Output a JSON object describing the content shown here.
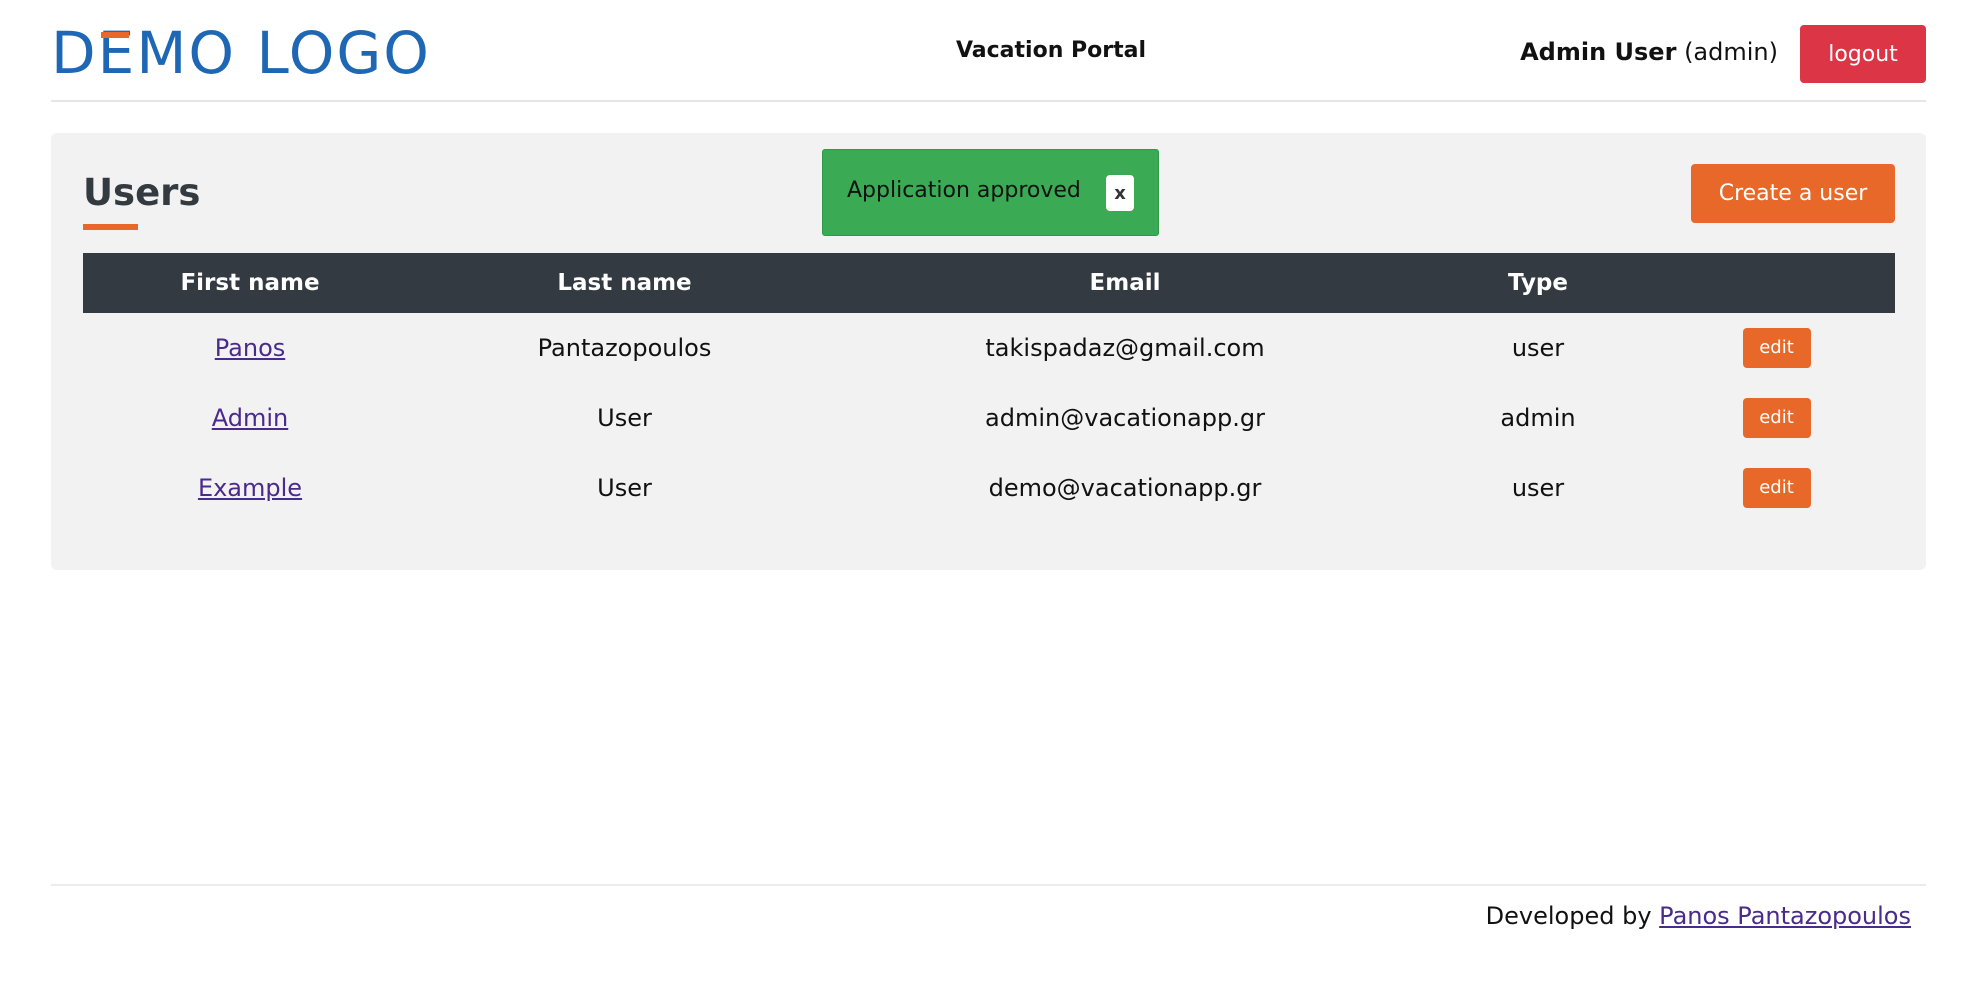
{
  "header": {
    "logo": {
      "part1": "D",
      "part2": "E",
      "part3": "MO LOGO",
      "accent_color": "#e8682a",
      "brand_color": "#1e67b4"
    },
    "portal_title": "Vacation Portal",
    "user_name": "Admin User",
    "user_role": "(admin)",
    "logout_label": "logout"
  },
  "main": {
    "section_title": "Users",
    "alert": {
      "message": "Application approved",
      "close_label": "x"
    },
    "create_label": "Create a user",
    "table": {
      "headers": [
        "First name",
        "Last name",
        "Email",
        "Type",
        ""
      ],
      "rows": [
        {
          "first_name": "Panos",
          "last_name": "Pantazopoulos",
          "email": "takispadaz@gmail.com",
          "type": "user",
          "action": "edit"
        },
        {
          "first_name": "Admin",
          "last_name": "User",
          "email": "admin@vacationapp.gr",
          "type": "admin",
          "action": "edit"
        },
        {
          "first_name": "Example",
          "last_name": "User",
          "email": "demo@vacationapp.gr",
          "type": "user",
          "action": "edit"
        }
      ]
    }
  },
  "footer": {
    "developed_by": "Developed by",
    "author": "Panos Pantazopoulos"
  },
  "colors": {
    "danger": "#dc3545",
    "accent": "#e8682a",
    "success": "#3aaa55",
    "table_header": "#343a42"
  }
}
